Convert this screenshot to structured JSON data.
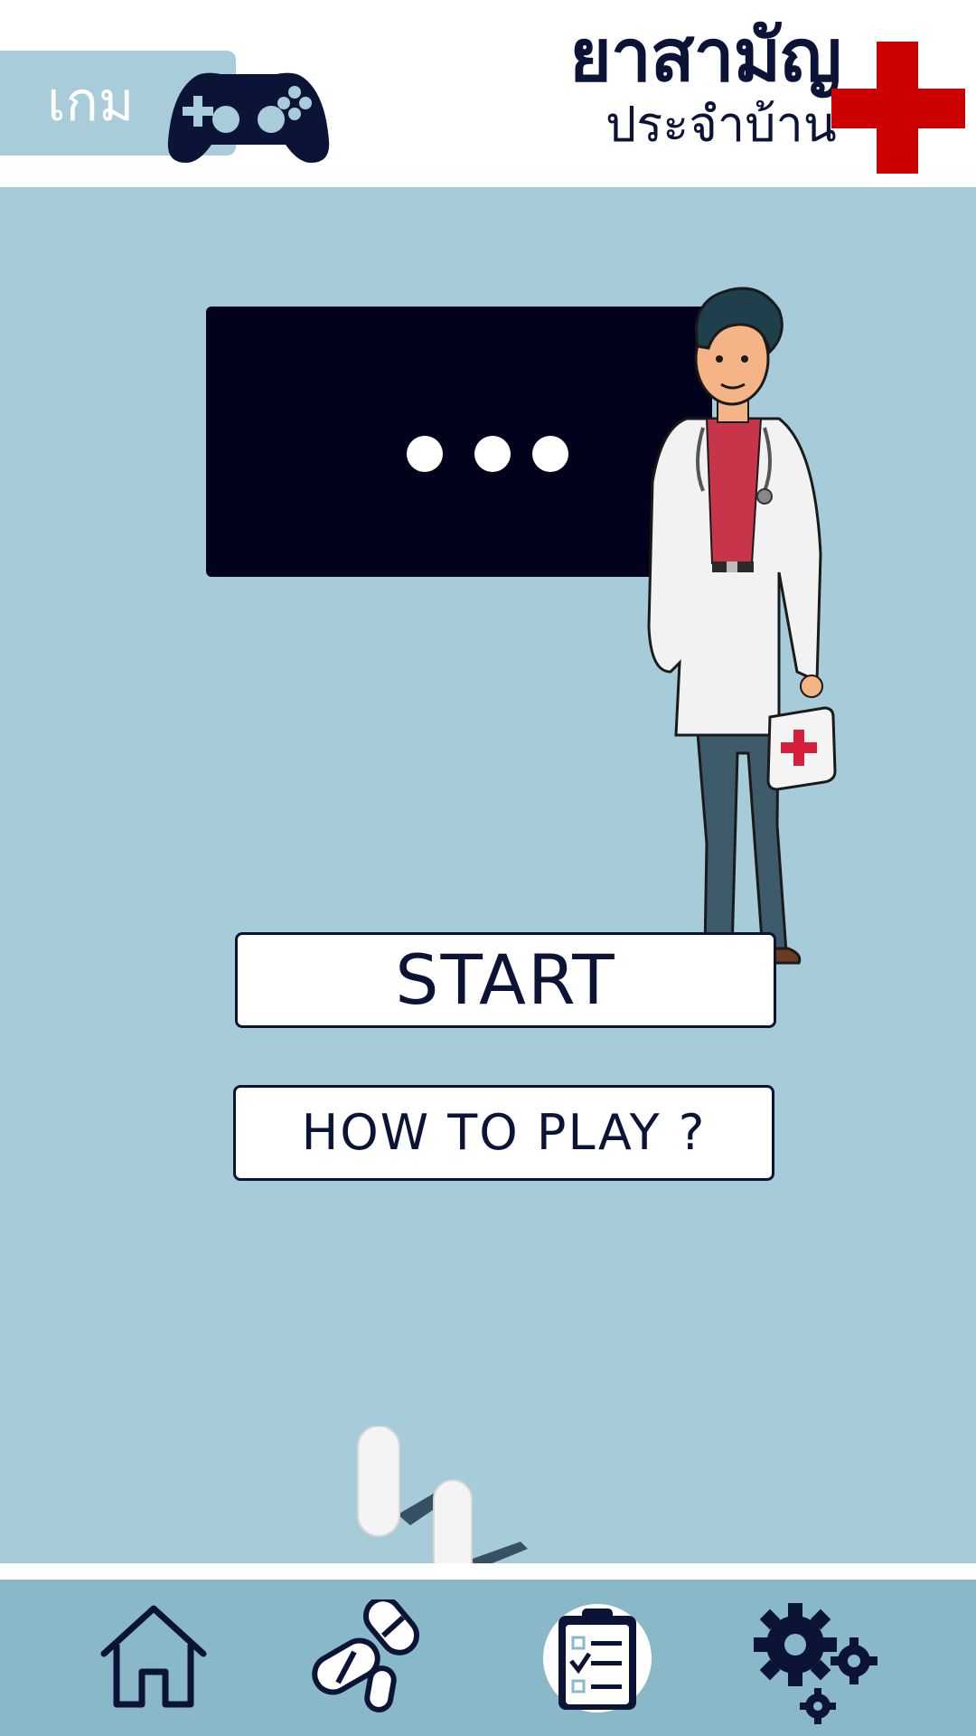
{
  "header": {
    "game_tab_label": "เกม",
    "app_title": "ยาสามัญ",
    "app_subtitle": "ประจำบ้าน",
    "cross_color": "#cc0000",
    "icons": [
      "gamepad-icon",
      "red-cross-icon"
    ]
  },
  "main": {
    "speech_box": {
      "content": "ellipsis-dots"
    },
    "buttons": {
      "start_label": "START",
      "howto_label": "HOW TO PLAY ?"
    },
    "illustrations": [
      "doctor-illustration",
      "pills-illustration"
    ]
  },
  "bottom_nav": {
    "items": [
      {
        "icon": "home-icon"
      },
      {
        "icon": "pills-icon"
      },
      {
        "icon": "clipboard-checklist-icon"
      },
      {
        "icon": "settings-gears-icon"
      }
    ]
  },
  "colors": {
    "background": "#a7ccd9",
    "nav_background": "#89b8c8",
    "dark_navy": "#0b1437",
    "speech_box": "#02021c",
    "accent_red": "#cc0000"
  }
}
